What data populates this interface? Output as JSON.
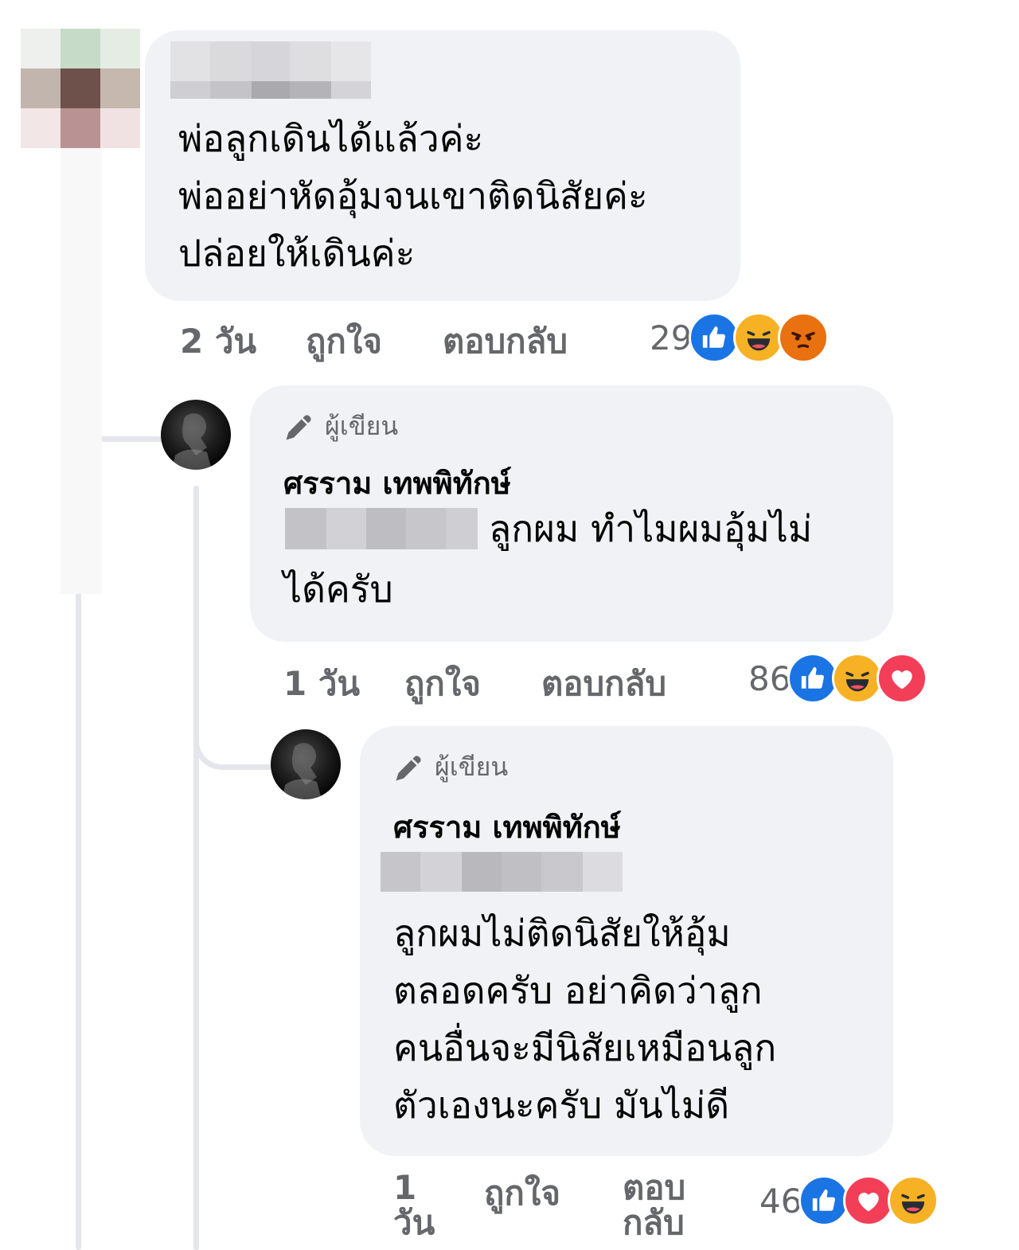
{
  "comment1": {
    "text": "พ่อลูกเดินได้แล้วค่ะ\nพ่ออย่าหัดอุ้มจนเขาติดนิสัยค่ะ\nปล่อยให้เดินค่ะ",
    "time": "2 วัน",
    "like_label": "ถูกใจ",
    "reply_label": "ตอบกลับ",
    "reaction_count": "29",
    "reactions": [
      "like",
      "haha",
      "angry"
    ]
  },
  "reply1": {
    "badge": "ผู้เขียน",
    "author": "ศรราม เทพพิทักษ์",
    "text_line1": "ลูกผม ทำไมผมอุ้มไม่",
    "text_line2": "ได้ครับ",
    "time": "1 วัน",
    "like_label": "ถูกใจ",
    "reply_label": "ตอบกลับ",
    "reaction_count": "86",
    "reactions": [
      "like",
      "haha",
      "love"
    ]
  },
  "reply2": {
    "badge": "ผู้เขียน",
    "author": "ศรราม เทพพิทักษ์",
    "text": "ลูกผมไม่ติดนิสัยให้อุ้ม\nตลอดครับ อย่าคิดว่าลูก\nคนอื่นจะมีนิสัยเหมือนลูก\nตัวเองนะครับ มันไม่ดี",
    "time": "1\nวัน",
    "like_label": "ถูกใจ",
    "reply_label": "ตอบ\nกลับ",
    "reaction_count": "46",
    "reactions": [
      "like",
      "love",
      "haha"
    ]
  },
  "colors": {
    "bubble": "#f0f2f5",
    "meta_text": "#65676b",
    "like": "#1b74e4",
    "haha": "#f7b125",
    "angry": "#e9710f",
    "love": "#f33e58"
  }
}
